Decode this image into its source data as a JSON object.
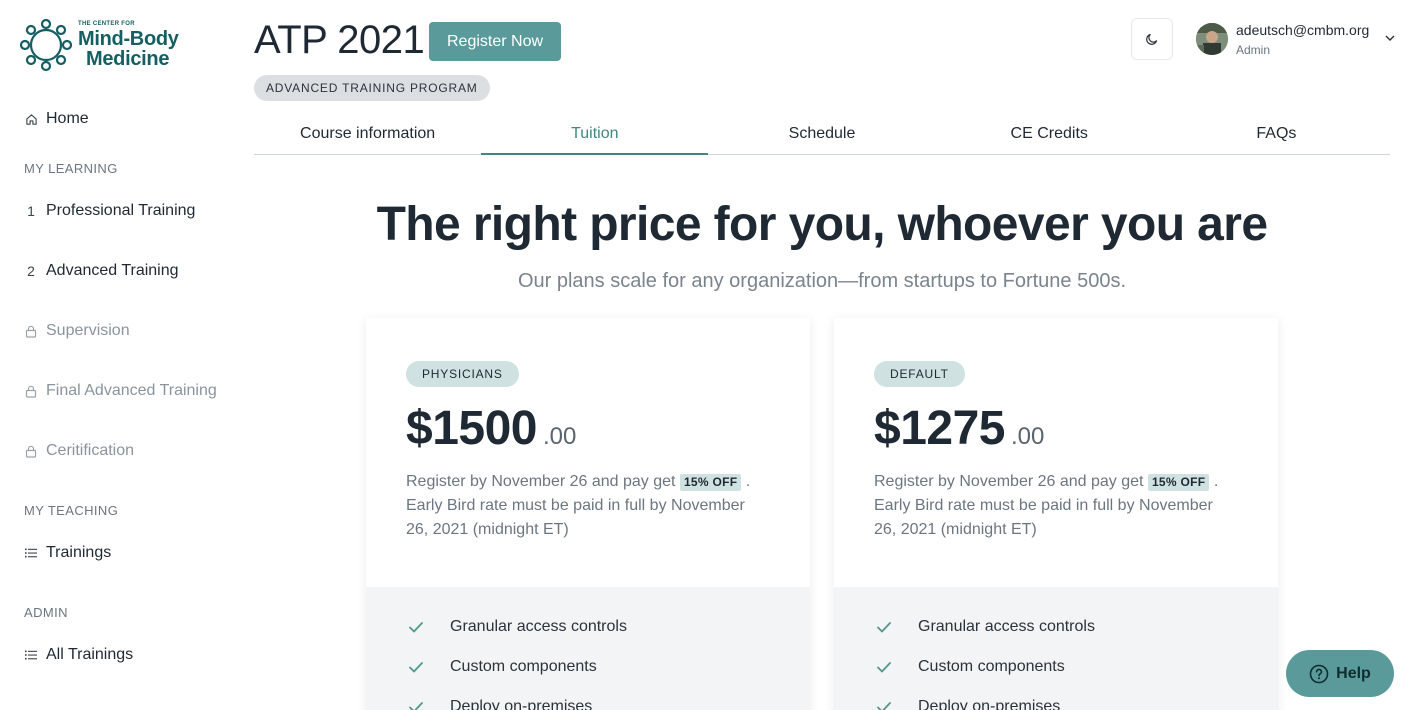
{
  "logo": {
    "small_text": "THE CENTER FOR",
    "line1": "Mind-Body",
    "line2": "Medicine"
  },
  "sidebar": {
    "home": {
      "label": "Home",
      "icon": "home-icon"
    },
    "sections": [
      {
        "heading": "MY LEARNING",
        "items": [
          {
            "marker": "1",
            "label": "Professional Training",
            "locked": false
          },
          {
            "marker": "2",
            "label": "Advanced Training",
            "locked": false
          },
          {
            "marker": "lock-icon",
            "label": "Supervision",
            "locked": true
          },
          {
            "marker": "lock-icon",
            "label": "Final Advanced Training",
            "locked": true
          },
          {
            "marker": "lock-icon",
            "label": "Ceritification",
            "locked": true
          }
        ]
      },
      {
        "heading": "MY TEACHING",
        "items": [
          {
            "marker": "list-icon",
            "label": "Trainings",
            "locked": false
          }
        ]
      },
      {
        "heading": "ADMIN",
        "items": [
          {
            "marker": "list-icon",
            "label": "All Trainings",
            "locked": false
          }
        ]
      }
    ]
  },
  "header": {
    "title": "ATP 2021",
    "register_label": "Register Now",
    "program_badge": "ADVANCED TRAINING PROGRAM",
    "theme_icon": "moon-icon",
    "user": {
      "email": "adeutsch@cmbm.org",
      "role": "Admin"
    }
  },
  "tabs": [
    {
      "label": "Course information",
      "active": false
    },
    {
      "label": "Tuition",
      "active": true
    },
    {
      "label": "Schedule",
      "active": false
    },
    {
      "label": "CE Credits",
      "active": false
    },
    {
      "label": "FAQs",
      "active": false
    }
  ],
  "hero": {
    "title": "The right price for you, whoever you are",
    "subtitle": "Our plans scale for any organization—from startups to Fortune 500s."
  },
  "plans": [
    {
      "badge": "PHYSICIANS",
      "price": "$1500",
      "cents": ".00",
      "desc_before": "Register by November 26 and pay get",
      "discount": "15% OFF",
      "desc_after": ". Early Bird rate must be paid in full by November 26, 2021 (midnight ET)",
      "features": [
        "Granular access controls",
        "Custom components",
        "Deploy on-premises"
      ]
    },
    {
      "badge": "DEFAULT",
      "price": "$1275",
      "cents": ".00",
      "desc_before": "Register by November 26 and pay get",
      "discount": "15% OFF",
      "desc_after": ". Early Bird rate must be paid in full by November 26, 2021 (midnight ET)",
      "features": [
        "Granular access controls",
        "Custom components",
        "Deploy on-premises"
      ]
    }
  ],
  "help": {
    "label": "Help"
  },
  "colors": {
    "brand": "#155f63",
    "accent": "#3e8783",
    "button": "#5a9a9a",
    "badge": "#cfe1e0"
  }
}
